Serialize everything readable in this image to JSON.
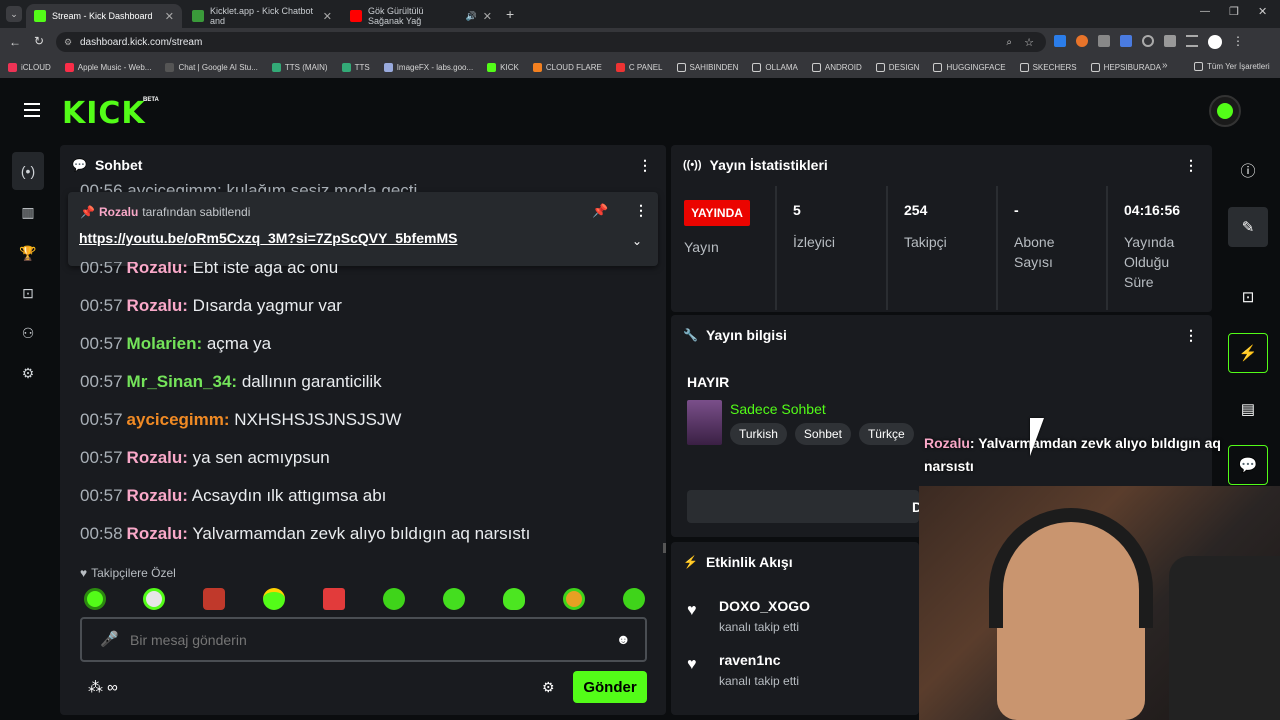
{
  "browser": {
    "tabs": [
      {
        "title": "Stream - Kick Dashboard",
        "color": "#53fc18"
      },
      {
        "title": "Kicklet.app - Kick Chatbot and",
        "color": "#3a9a3a"
      },
      {
        "title": "Gök Gürültülü Sağanak Yağ",
        "color": "#ff0000"
      }
    ],
    "url": "dashboard.kick.com/stream",
    "bookmarks": [
      "iCLOUD",
      "Apple Music - Web...",
      "Chat | Google AI Stu...",
      "TTS (MAIN)",
      "TTS",
      "ImageFX - labs.goo...",
      "KICK",
      "CLOUD FLARE",
      "C PANEL",
      "SAHIBINDEN",
      "OLLAMA",
      "ANDROID",
      "DESIGN",
      "HUGGINGFACE",
      "SKECHERS",
      "HEPSIBURADA"
    ],
    "all_bookmarks": "Tüm Yer İşaretleri"
  },
  "app": {
    "logo": "KICK",
    "beta": "BETA"
  },
  "chat": {
    "title": "Sohbet",
    "partial_line": "00:56 aycicegimm: kulağım sesiz moda geçti",
    "pinned": {
      "by_name": "Rozalu",
      "by_text": "tarafından sabitlendi",
      "link": "https://youtu.be/oRm5Cxzq_3M?si=7ZpScQVY_5bfemMS"
    },
    "partial_line2": {
      "time": "00:57",
      "user": "Rozalu:",
      "text": "Ebt iste aga ac onu"
    },
    "messages": [
      {
        "time": "00:57",
        "user": "Rozalu:",
        "text": "Dısarda yagmur var",
        "color": "pink"
      },
      {
        "time": "00:57",
        "user": "Molarien:",
        "text": "açma ya",
        "color": "green"
      },
      {
        "time": "00:57",
        "user": "Mr_Sinan_34:",
        "text": "dallının garanticilik",
        "color": "green"
      },
      {
        "time": "00:57",
        "user": "aycicegimm:",
        "text": "NXHSHSJSJNSJSJW",
        "color": "orange"
      },
      {
        "time": "00:57",
        "user": "Rozalu:",
        "text": "ya sen acmıypsun",
        "color": "pink"
      },
      {
        "time": "00:57",
        "user": "Rozalu:",
        "text": "Acsaydın ılk attıgımsa abı",
        "color": "pink"
      },
      {
        "time": "00:58",
        "user": "Rozalu:",
        "text": "Yalvarmamdan zevk alıyo bıldıgın aq narsıstı",
        "color": "pink"
      }
    ],
    "followers_only": "Takipçilere Özel",
    "input_placeholder": "Bir mesaj gönderin",
    "send": "Gönder"
  },
  "stats": {
    "title": "Yayın İstatistikleri",
    "live_badge": "YAYINDA",
    "live_label": "Yayın",
    "items": [
      {
        "value": "5",
        "label": "İzleyici"
      },
      {
        "value": "254",
        "label": "Takipçi"
      },
      {
        "value": "-",
        "label": "Abone Sayısı"
      },
      {
        "value": "04:16:56",
        "label": "Yayında Olduğu Süre"
      }
    ]
  },
  "info": {
    "title": "Yayın bilgisi",
    "heading": "HAYIR",
    "category": "Sadece Sohbet",
    "tags": [
      "Turkish",
      "Sohbet",
      "Türkçe"
    ],
    "button_partial": "D"
  },
  "overlay": {
    "user": "Rozalu",
    "text": ": Yalvarmamdan zevk alıyo bıldıgın aq narsıstı"
  },
  "activity": {
    "title": "Etkinlik Akışı",
    "items": [
      {
        "user": "DOXO_XOGO",
        "text": "kanalı takip etti"
      },
      {
        "user": "raven1nc",
        "text": "kanalı takip etti"
      }
    ]
  }
}
